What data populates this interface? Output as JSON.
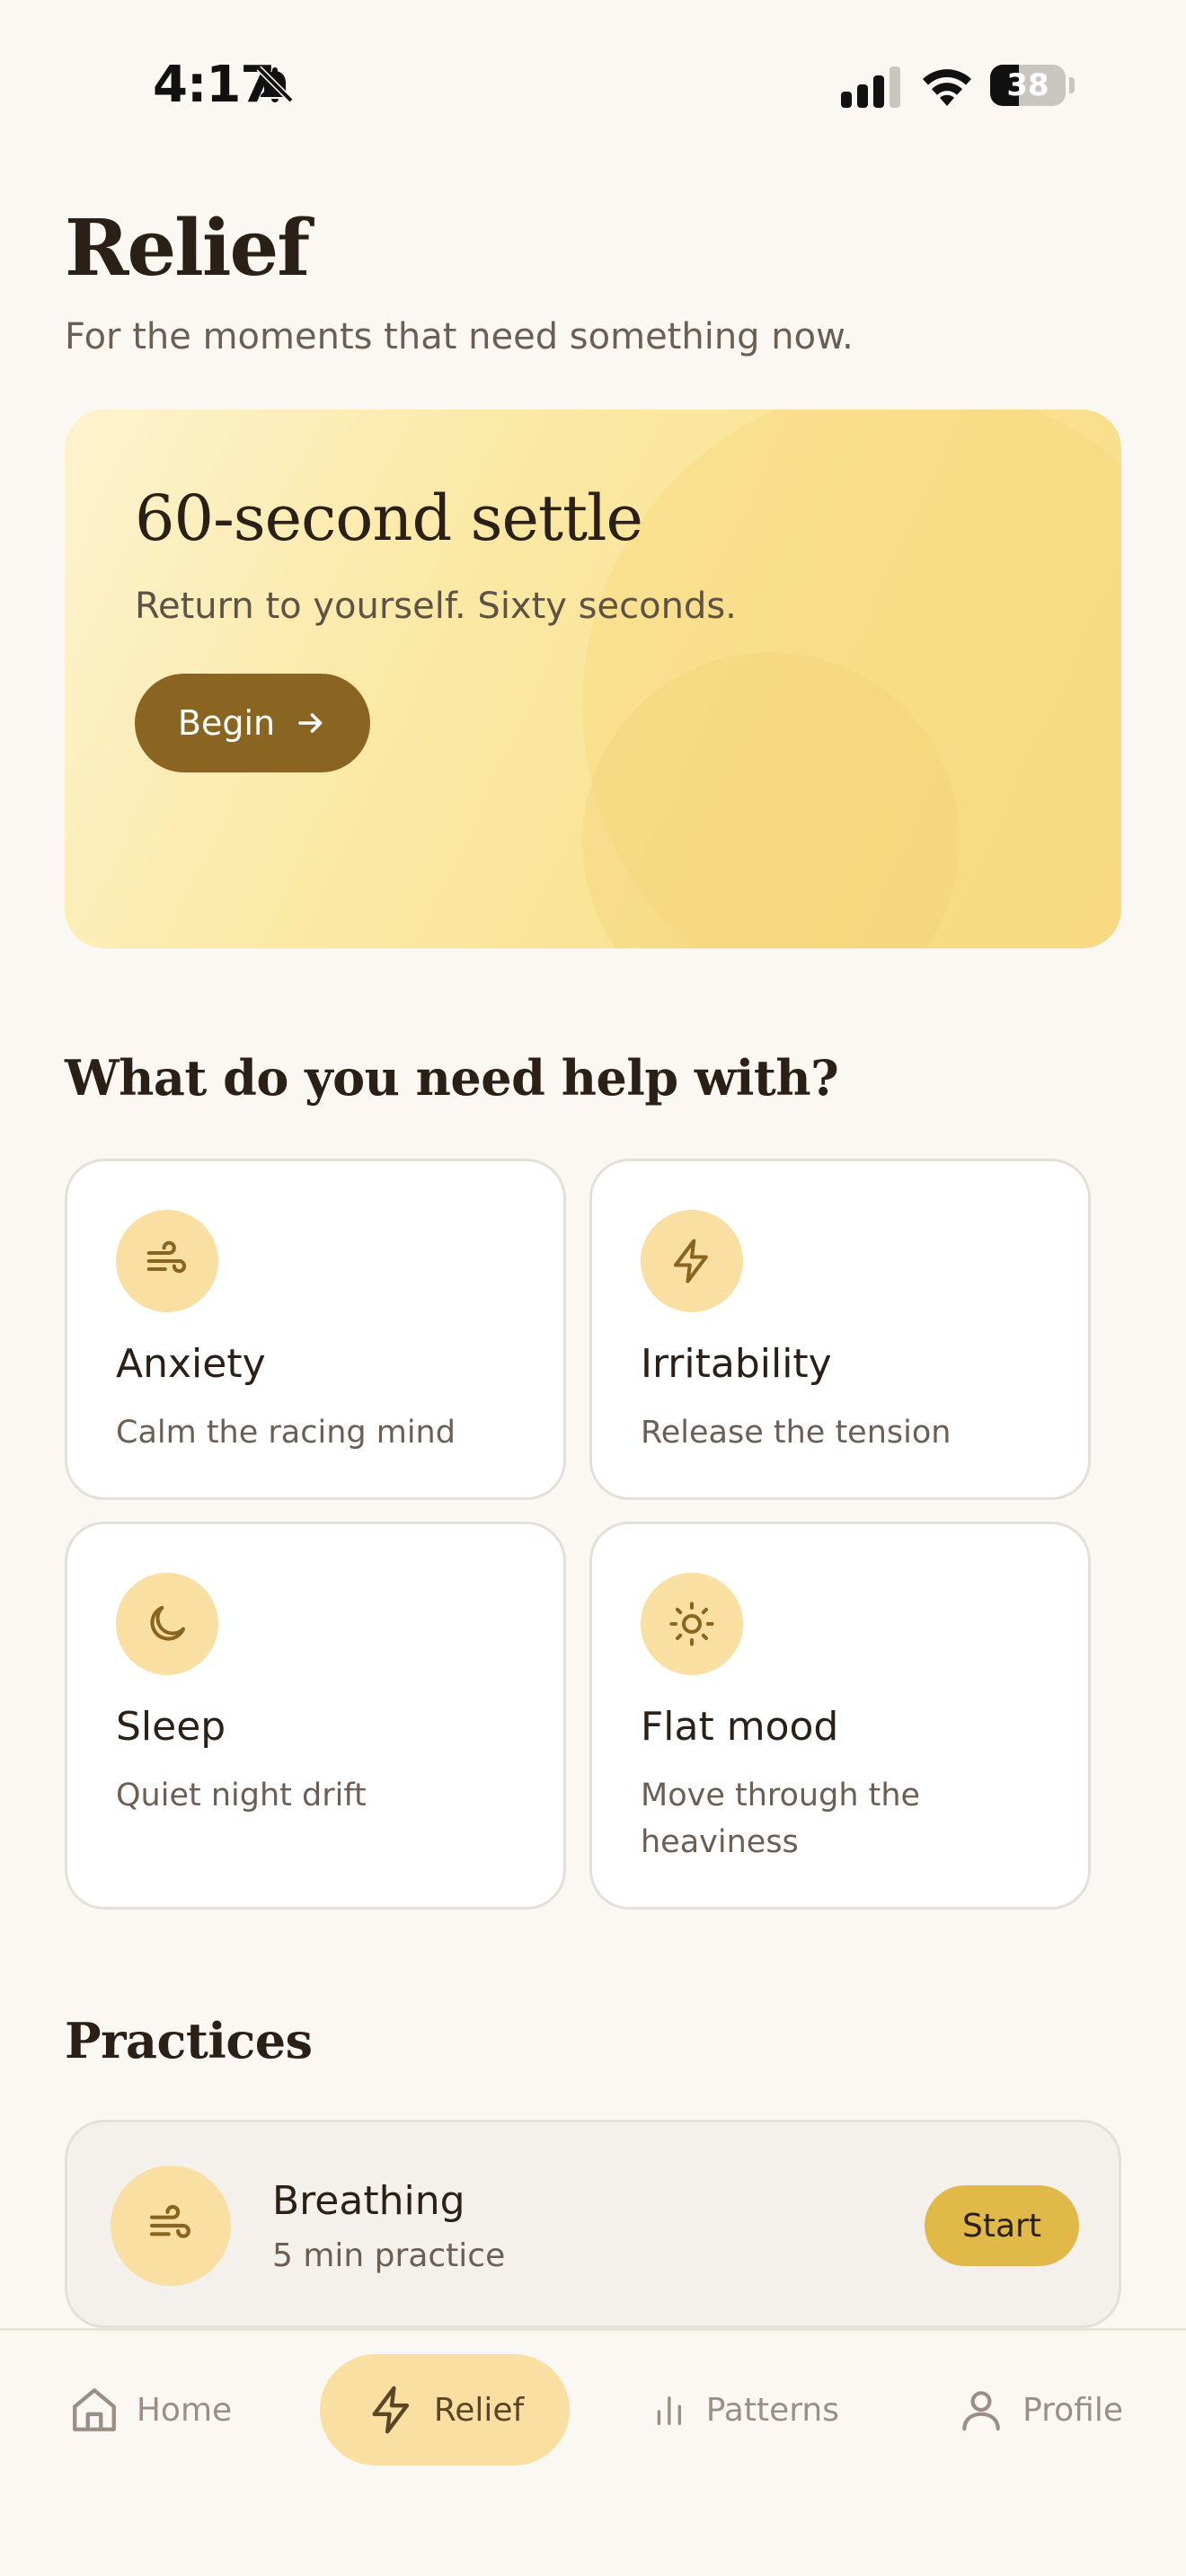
{
  "status_bar": {
    "time": "4:17",
    "battery_level": "38",
    "battery_fraction": 0.38,
    "icons": [
      "bell-slash-icon",
      "cellular-signal-icon",
      "wifi-icon",
      "battery-icon"
    ]
  },
  "header": {
    "title": "Relief",
    "subtitle": "For the moments that need something now."
  },
  "hero": {
    "title": "60-second settle",
    "text": "Return to yourself. Sixty seconds.",
    "button_label": "Begin",
    "button_icon": "arrow-right-icon"
  },
  "help_section": {
    "heading": "What do you need help with?",
    "items": [
      {
        "title": "Anxiety",
        "description": "Calm the racing mind",
        "icon": "wind-icon"
      },
      {
        "title": "Irritability",
        "description": "Release the tension",
        "icon": "lightning-icon"
      },
      {
        "title": "Sleep",
        "description": "Quiet night drift",
        "icon": "moon-icon"
      },
      {
        "title": "Flat mood",
        "description": "Move through the heaviness",
        "icon": "sun-icon"
      }
    ]
  },
  "practices": {
    "heading": "Practices",
    "items": [
      {
        "title": "Breathing",
        "meta": "5 min practice",
        "button_label": "Start",
        "icon": "wind-icon"
      }
    ]
  },
  "bottom_nav": {
    "items": [
      {
        "label": "Home",
        "icon": "home-icon",
        "active": false
      },
      {
        "label": "Relief",
        "icon": "lightning-icon",
        "active": true
      },
      {
        "label": "Patterns",
        "icon": "bar-chart-icon",
        "active": false
      },
      {
        "label": "Profile",
        "icon": "person-icon",
        "active": false
      }
    ]
  },
  "colors": {
    "background": "#fbf8f3",
    "accent_brown": "#8a6521",
    "accent_yellow": "#e0b948",
    "icon_circle": "#f9e0a2"
  }
}
